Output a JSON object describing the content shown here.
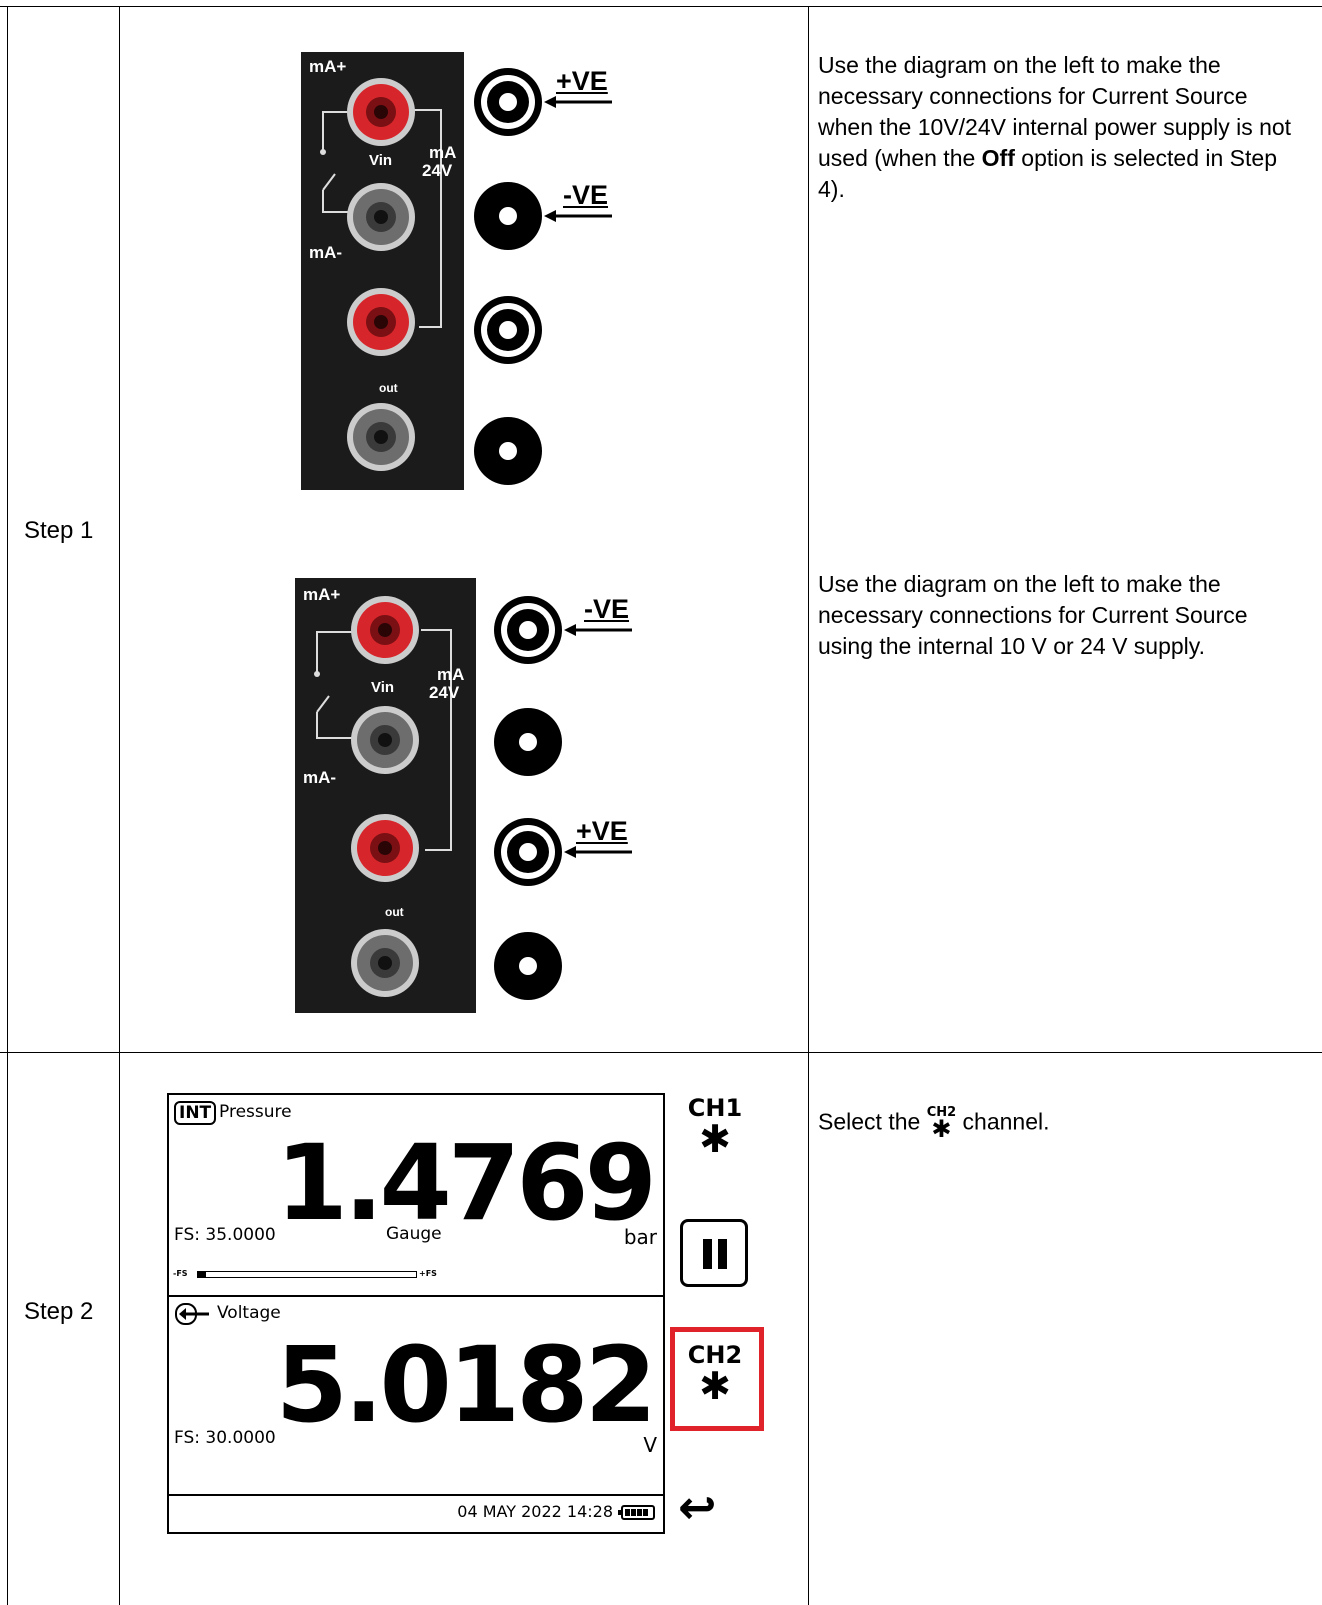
{
  "rows": [
    {
      "step": "Step 1",
      "descriptions": [
        {
          "before": "Use the diagram on the left to make the necessary connections for Current Source when the 10V/24V internal power supply is not used (when the ",
          "bold": "Off",
          "after": " option is selected in Step 4)."
        },
        {
          "text": "Use the diagram on the left to make the necessary connections for Current Source using the internal 10 V or 24 V supply."
        }
      ],
      "diagram1": {
        "labels": [
          "+VE",
          "-VE"
        ]
      },
      "diagram2": {
        "labels": [
          "-VE",
          "+VE"
        ]
      }
    },
    {
      "step": "Step 2",
      "description": {
        "before": "Select the ",
        "after": " channel.",
        "icon_label": "CH2"
      }
    }
  ],
  "panel_labels": {
    "ma_plus": "mA+",
    "v_in": "Vin",
    "ma": "mA",
    "v24": "24V",
    "ma_minus": "mA-",
    "out": "out"
  },
  "screen": {
    "ch1": {
      "badge": "INT",
      "title": "Pressure",
      "value": "1.4769",
      "fs": "FS: 35.0000",
      "type": "Gauge",
      "unit": "bar",
      "bar_min": "-FS",
      "bar_max": "+FS",
      "bar_fraction": 0.04
    },
    "ch2": {
      "title": "Voltage",
      "value": "5.0182",
      "fs": "FS: 30.0000",
      "unit": "V"
    },
    "datetime": "04 MAY 2022 14:28",
    "side": {
      "ch1": "CH1",
      "ch2": "CH2"
    }
  },
  "colors": {
    "highlight": "#e0232a",
    "terminal_red": "#d7262b",
    "terminal_grey": "#8a8a8a"
  }
}
